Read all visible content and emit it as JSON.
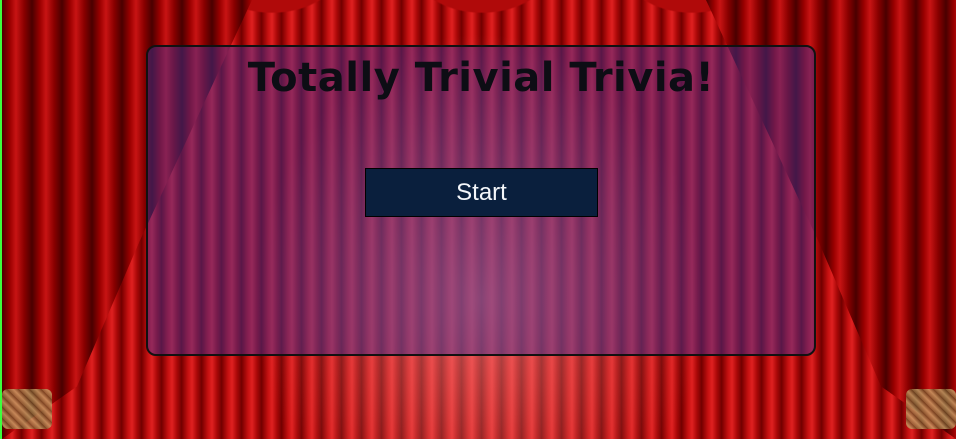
{
  "app": {
    "title": "Totally Trivial Trivia!"
  },
  "panel": {
    "start_label": "Start"
  },
  "colors": {
    "curtain_red": "#c41010",
    "panel_overlay": "#3c32a0",
    "button_bg": "#0a1f3d",
    "button_text": "#f4f6fa",
    "title_text": "#0d0d14"
  },
  "background": {
    "scene": "red theater curtains"
  }
}
